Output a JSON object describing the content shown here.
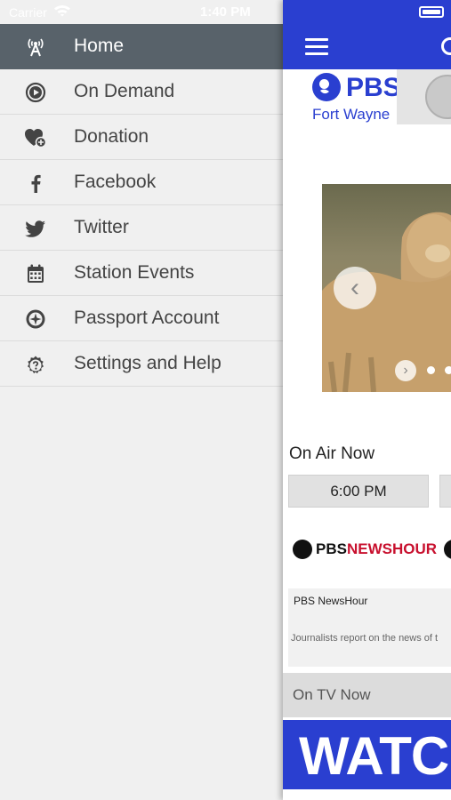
{
  "status_bar": {
    "carrier": "Carrier",
    "time": "1:40 PM"
  },
  "side_menu": {
    "items": [
      {
        "label": "Home",
        "icon": "tower-icon",
        "active": true
      },
      {
        "label": "On Demand",
        "icon": "play-circle-icon",
        "active": false
      },
      {
        "label": "Donation",
        "icon": "heart-plus-icon",
        "active": false
      },
      {
        "label": "Facebook",
        "icon": "facebook-icon",
        "active": false
      },
      {
        "label": "Twitter",
        "icon": "twitter-icon",
        "active": false
      },
      {
        "label": "Station Events",
        "icon": "calendar-icon",
        "active": false
      },
      {
        "label": "Passport Account",
        "icon": "compass-icon",
        "active": false
      },
      {
        "label": "Settings and Help",
        "icon": "help-icon",
        "active": false
      }
    ]
  },
  "main": {
    "station_logo": {
      "brand": "PBS",
      "name": "Fort Wayne"
    },
    "on_air_title": "On Air Now",
    "schedule_time": "6:00 PM",
    "program_logo": {
      "prefix": "PBS",
      "name": "NEWSHOUR"
    },
    "program": {
      "title": "PBS NewsHour",
      "description": "Journalists report on the news of t"
    },
    "on_tv_label": "On TV Now",
    "banner_text": "WATC"
  },
  "colors": {
    "accent": "#2a3fd0",
    "menu_active": "#58626a",
    "menu_bg": "#f0f0f0",
    "newshour_red": "#c8102e"
  }
}
